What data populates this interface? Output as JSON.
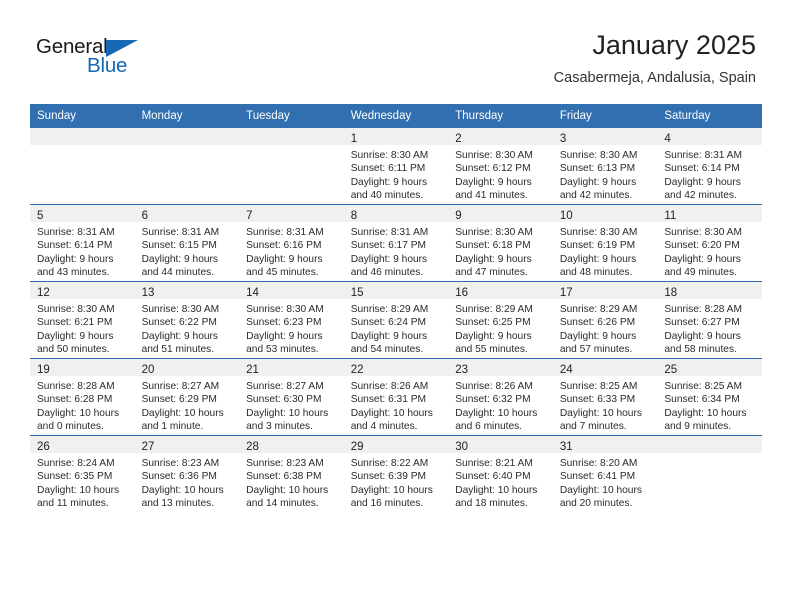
{
  "brand": {
    "name_part1": "General",
    "name_part2": "Blue",
    "flag_color": "#1668b3"
  },
  "header": {
    "title": "January 2025",
    "subtitle": "Casabermeja, Andalusia, Spain"
  },
  "theme": {
    "header_bg": "#316fb0",
    "row_divider": "#2a6db0",
    "daynum_band": "#f0f0f0",
    "text": "#2b2b2b"
  },
  "weekdays": [
    "Sunday",
    "Monday",
    "Tuesday",
    "Wednesday",
    "Thursday",
    "Friday",
    "Saturday"
  ],
  "weeks": [
    [
      {
        "day": "",
        "lines": [
          "",
          "",
          "",
          ""
        ],
        "empty": true
      },
      {
        "day": "",
        "lines": [
          "",
          "",
          "",
          ""
        ],
        "empty": true
      },
      {
        "day": "",
        "lines": [
          "",
          "",
          "",
          ""
        ],
        "empty": true
      },
      {
        "day": "1",
        "lines": [
          "Sunrise: 8:30 AM",
          "Sunset: 6:11 PM",
          "Daylight: 9 hours",
          "and 40 minutes."
        ],
        "empty": false
      },
      {
        "day": "2",
        "lines": [
          "Sunrise: 8:30 AM",
          "Sunset: 6:12 PM",
          "Daylight: 9 hours",
          "and 41 minutes."
        ],
        "empty": false
      },
      {
        "day": "3",
        "lines": [
          "Sunrise: 8:30 AM",
          "Sunset: 6:13 PM",
          "Daylight: 9 hours",
          "and 42 minutes."
        ],
        "empty": false
      },
      {
        "day": "4",
        "lines": [
          "Sunrise: 8:31 AM",
          "Sunset: 6:14 PM",
          "Daylight: 9 hours",
          "and 42 minutes."
        ],
        "empty": false
      }
    ],
    [
      {
        "day": "5",
        "lines": [
          "Sunrise: 8:31 AM",
          "Sunset: 6:14 PM",
          "Daylight: 9 hours",
          "and 43 minutes."
        ],
        "empty": false
      },
      {
        "day": "6",
        "lines": [
          "Sunrise: 8:31 AM",
          "Sunset: 6:15 PM",
          "Daylight: 9 hours",
          "and 44 minutes."
        ],
        "empty": false
      },
      {
        "day": "7",
        "lines": [
          "Sunrise: 8:31 AM",
          "Sunset: 6:16 PM",
          "Daylight: 9 hours",
          "and 45 minutes."
        ],
        "empty": false
      },
      {
        "day": "8",
        "lines": [
          "Sunrise: 8:31 AM",
          "Sunset: 6:17 PM",
          "Daylight: 9 hours",
          "and 46 minutes."
        ],
        "empty": false
      },
      {
        "day": "9",
        "lines": [
          "Sunrise: 8:30 AM",
          "Sunset: 6:18 PM",
          "Daylight: 9 hours",
          "and 47 minutes."
        ],
        "empty": false
      },
      {
        "day": "10",
        "lines": [
          "Sunrise: 8:30 AM",
          "Sunset: 6:19 PM",
          "Daylight: 9 hours",
          "and 48 minutes."
        ],
        "empty": false
      },
      {
        "day": "11",
        "lines": [
          "Sunrise: 8:30 AM",
          "Sunset: 6:20 PM",
          "Daylight: 9 hours",
          "and 49 minutes."
        ],
        "empty": false
      }
    ],
    [
      {
        "day": "12",
        "lines": [
          "Sunrise: 8:30 AM",
          "Sunset: 6:21 PM",
          "Daylight: 9 hours",
          "and 50 minutes."
        ],
        "empty": false
      },
      {
        "day": "13",
        "lines": [
          "Sunrise: 8:30 AM",
          "Sunset: 6:22 PM",
          "Daylight: 9 hours",
          "and 51 minutes."
        ],
        "empty": false
      },
      {
        "day": "14",
        "lines": [
          "Sunrise: 8:30 AM",
          "Sunset: 6:23 PM",
          "Daylight: 9 hours",
          "and 53 minutes."
        ],
        "empty": false
      },
      {
        "day": "15",
        "lines": [
          "Sunrise: 8:29 AM",
          "Sunset: 6:24 PM",
          "Daylight: 9 hours",
          "and 54 minutes."
        ],
        "empty": false
      },
      {
        "day": "16",
        "lines": [
          "Sunrise: 8:29 AM",
          "Sunset: 6:25 PM",
          "Daylight: 9 hours",
          "and 55 minutes."
        ],
        "empty": false
      },
      {
        "day": "17",
        "lines": [
          "Sunrise: 8:29 AM",
          "Sunset: 6:26 PM",
          "Daylight: 9 hours",
          "and 57 minutes."
        ],
        "empty": false
      },
      {
        "day": "18",
        "lines": [
          "Sunrise: 8:28 AM",
          "Sunset: 6:27 PM",
          "Daylight: 9 hours",
          "and 58 minutes."
        ],
        "empty": false
      }
    ],
    [
      {
        "day": "19",
        "lines": [
          "Sunrise: 8:28 AM",
          "Sunset: 6:28 PM",
          "Daylight: 10 hours",
          "and 0 minutes."
        ],
        "empty": false
      },
      {
        "day": "20",
        "lines": [
          "Sunrise: 8:27 AM",
          "Sunset: 6:29 PM",
          "Daylight: 10 hours",
          "and 1 minute."
        ],
        "empty": false
      },
      {
        "day": "21",
        "lines": [
          "Sunrise: 8:27 AM",
          "Sunset: 6:30 PM",
          "Daylight: 10 hours",
          "and 3 minutes."
        ],
        "empty": false
      },
      {
        "day": "22",
        "lines": [
          "Sunrise: 8:26 AM",
          "Sunset: 6:31 PM",
          "Daylight: 10 hours",
          "and 4 minutes."
        ],
        "empty": false
      },
      {
        "day": "23",
        "lines": [
          "Sunrise: 8:26 AM",
          "Sunset: 6:32 PM",
          "Daylight: 10 hours",
          "and 6 minutes."
        ],
        "empty": false
      },
      {
        "day": "24",
        "lines": [
          "Sunrise: 8:25 AM",
          "Sunset: 6:33 PM",
          "Daylight: 10 hours",
          "and 7 minutes."
        ],
        "empty": false
      },
      {
        "day": "25",
        "lines": [
          "Sunrise: 8:25 AM",
          "Sunset: 6:34 PM",
          "Daylight: 10 hours",
          "and 9 minutes."
        ],
        "empty": false
      }
    ],
    [
      {
        "day": "26",
        "lines": [
          "Sunrise: 8:24 AM",
          "Sunset: 6:35 PM",
          "Daylight: 10 hours",
          "and 11 minutes."
        ],
        "empty": false
      },
      {
        "day": "27",
        "lines": [
          "Sunrise: 8:23 AM",
          "Sunset: 6:36 PM",
          "Daylight: 10 hours",
          "and 13 minutes."
        ],
        "empty": false
      },
      {
        "day": "28",
        "lines": [
          "Sunrise: 8:23 AM",
          "Sunset: 6:38 PM",
          "Daylight: 10 hours",
          "and 14 minutes."
        ],
        "empty": false
      },
      {
        "day": "29",
        "lines": [
          "Sunrise: 8:22 AM",
          "Sunset: 6:39 PM",
          "Daylight: 10 hours",
          "and 16 minutes."
        ],
        "empty": false
      },
      {
        "day": "30",
        "lines": [
          "Sunrise: 8:21 AM",
          "Sunset: 6:40 PM",
          "Daylight: 10 hours",
          "and 18 minutes."
        ],
        "empty": false
      },
      {
        "day": "31",
        "lines": [
          "Sunrise: 8:20 AM",
          "Sunset: 6:41 PM",
          "Daylight: 10 hours",
          "and 20 minutes."
        ],
        "empty": false
      },
      {
        "day": "",
        "lines": [
          "",
          "",
          "",
          ""
        ],
        "empty": true
      }
    ]
  ]
}
